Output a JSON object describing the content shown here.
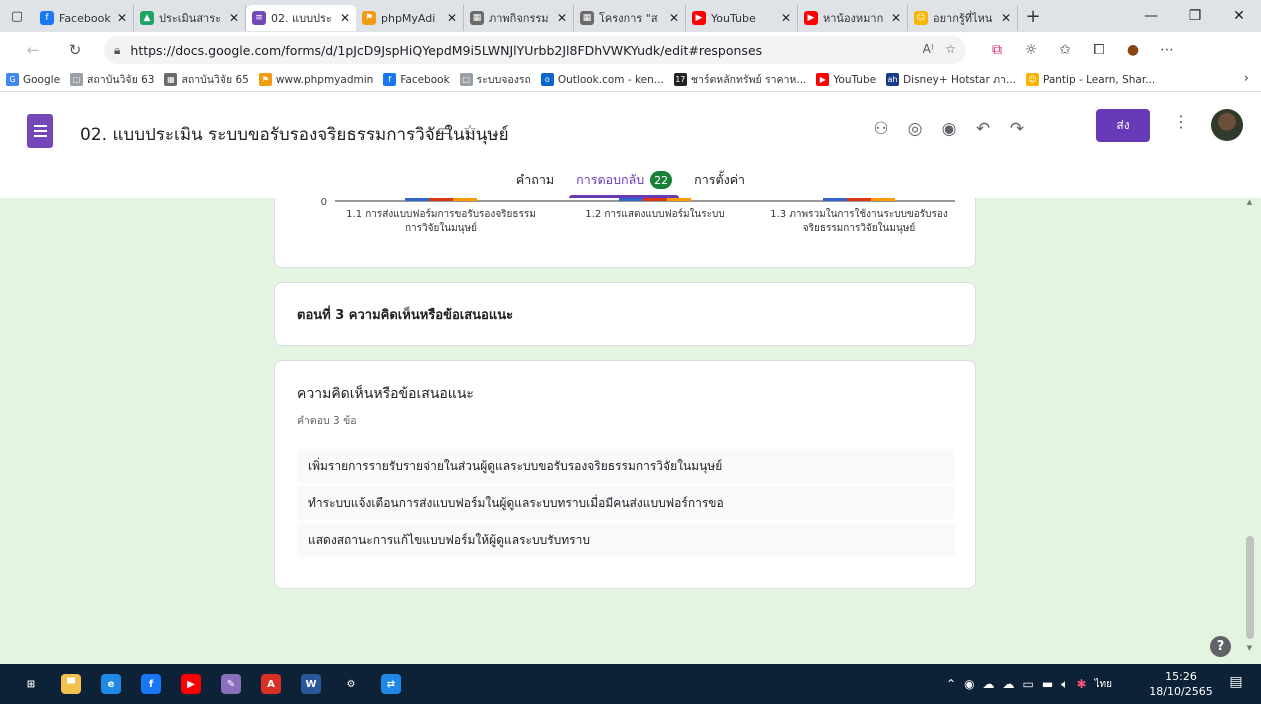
{
  "browser": {
    "tabs": [
      {
        "label": "Facebook",
        "color": "#1877f2",
        "glyph": "f",
        "width": 100
      },
      {
        "label": "ประเมินสาระ",
        "color": "#1fa463",
        "glyph": "▲",
        "width": 112
      },
      {
        "label": "02. แบบประ",
        "color": "#7248b9",
        "glyph": "≡",
        "width": 110,
        "active": true
      },
      {
        "label": "phpMyAdi",
        "color": "#f29c11",
        "glyph": "⚑",
        "width": 108
      },
      {
        "label": "ภาพกิจกรรม",
        "color": "#6b6b6b",
        "glyph": "▦",
        "width": 110
      },
      {
        "label": "โครงการ \"ส",
        "color": "#6b6b6b",
        "glyph": "▦",
        "width": 112
      },
      {
        "label": "YouTube",
        "color": "#ff0000",
        "glyph": "▶",
        "width": 112
      },
      {
        "label": "หาน้องหมาก",
        "color": "#ff0000",
        "glyph": "▶",
        "width": 110
      },
      {
        "label": "อยากรู้ที่ไหน",
        "color": "#f7b500",
        "glyph": "☺",
        "width": 110
      }
    ],
    "url": "https://docs.google.com/forms/d/1pJcD9JspHiQYepdM9i5LWNJlYUrbb2Jl8FDhVWKYudk/edit#responses",
    "bookmarks": [
      {
        "label": "Google",
        "color": "#4285f4",
        "glyph": "G"
      },
      {
        "label": "สถาบันวิจัย 63",
        "color": "#9aa0a6",
        "glyph": "▢"
      },
      {
        "label": "สถาบันวิจัย 65",
        "color": "#6b6b6b",
        "glyph": "▦"
      },
      {
        "label": "www.phpmyadmin",
        "color": "#f29c11",
        "glyph": "⚑"
      },
      {
        "label": "Facebook",
        "color": "#1877f2",
        "glyph": "f"
      },
      {
        "label": "ระบบจองรถ",
        "color": "#9aa0a6",
        "glyph": "▢"
      },
      {
        "label": "Outlook.com - ken...",
        "color": "#0a64c9",
        "glyph": "o"
      },
      {
        "label": "ชาร์ตหลักทรัพย์ ราคาห...",
        "color": "#222222",
        "glyph": "17"
      },
      {
        "label": "YouTube",
        "color": "#ff0000",
        "glyph": "▶"
      },
      {
        "label": "Disney+ Hotstar ภา...",
        "color": "#1a3a8a",
        "glyph": "ah"
      },
      {
        "label": "Pantip - Learn, Shar...",
        "color": "#f7b500",
        "glyph": "☺"
      }
    ]
  },
  "form": {
    "title": "02. แบบประเมิน ระบบขอรับรองจริยธรรมการวิจัยในมนุษย์",
    "send_label": "ส่ง",
    "tabs": {
      "questions": "คำถาม",
      "responses": "การตอบกลับ",
      "responses_count": "22",
      "settings": "การตั้งค่า"
    }
  },
  "chart_data": {
    "type": "bar",
    "categories": [
      [
        "1.1 การส่งแบบฟอร์มการขอรับรองจริยธรรม",
        "การวิจัยในมนุษย์"
      ],
      [
        "1.2 การแสดงแบบฟอร์มในระบบ"
      ],
      [
        "1.3 ภาพรวมในการใช้งานระบบขอรับรอง",
        "จริยธรรมการวิจัยในมนุษย์"
      ]
    ],
    "series_colors": [
      "#3366cc",
      "#dc3912",
      "#ff9900"
    ],
    "y_tick_zero": "0"
  },
  "sections": {
    "part3_title": "ตอนที่ 3 ความคิดเห็นหรือข้อเสนอแนะ"
  },
  "question": {
    "title": "ความคิดเห็นหรือข้อเสนอแนะ",
    "count": "คำตอบ 3 ข้อ",
    "answers": [
      "เพิ่มรายการรายรับรายจ่ายในส่วนผู้ดูแลระบบขอรับรองจริยธรรมการวิจัยในมนุษย์",
      "ทำระบบแจ้งเตือนการส่งแบบฟอร์มในผู้ดูแลระบบทราบเมื่อมีคนส่งแบบฟอร์การขอ",
      "แสดงสถานะการแก้ไขแบบฟอร์มให้ผู้ดูแลระบบรับทราบ"
    ]
  },
  "taskbar": {
    "apps": [
      {
        "name": "windows-start",
        "color": "#0d2137",
        "glyph": "⊞"
      },
      {
        "name": "file-explorer",
        "color": "#f2c14e",
        "glyph": "▀"
      },
      {
        "name": "edge",
        "color": "#1e88e5",
        "glyph": "e"
      },
      {
        "name": "facebook",
        "color": "#1877f2",
        "glyph": "f"
      },
      {
        "name": "youtube",
        "color": "#ff0000",
        "glyph": "▶"
      },
      {
        "name": "paint",
        "color": "#8a6fbf",
        "glyph": "✎"
      },
      {
        "name": "acrobat",
        "color": "#d93025",
        "glyph": "A"
      },
      {
        "name": "word",
        "color": "#2b579a",
        "glyph": "W"
      },
      {
        "name": "settings",
        "color": "#0d2137",
        "glyph": "⚙"
      },
      {
        "name": "teamviewer",
        "color": "#1e88e5",
        "glyph": "⇄"
      }
    ],
    "lang": "ไทย",
    "time": "15:26",
    "date": "18/10/2565"
  }
}
